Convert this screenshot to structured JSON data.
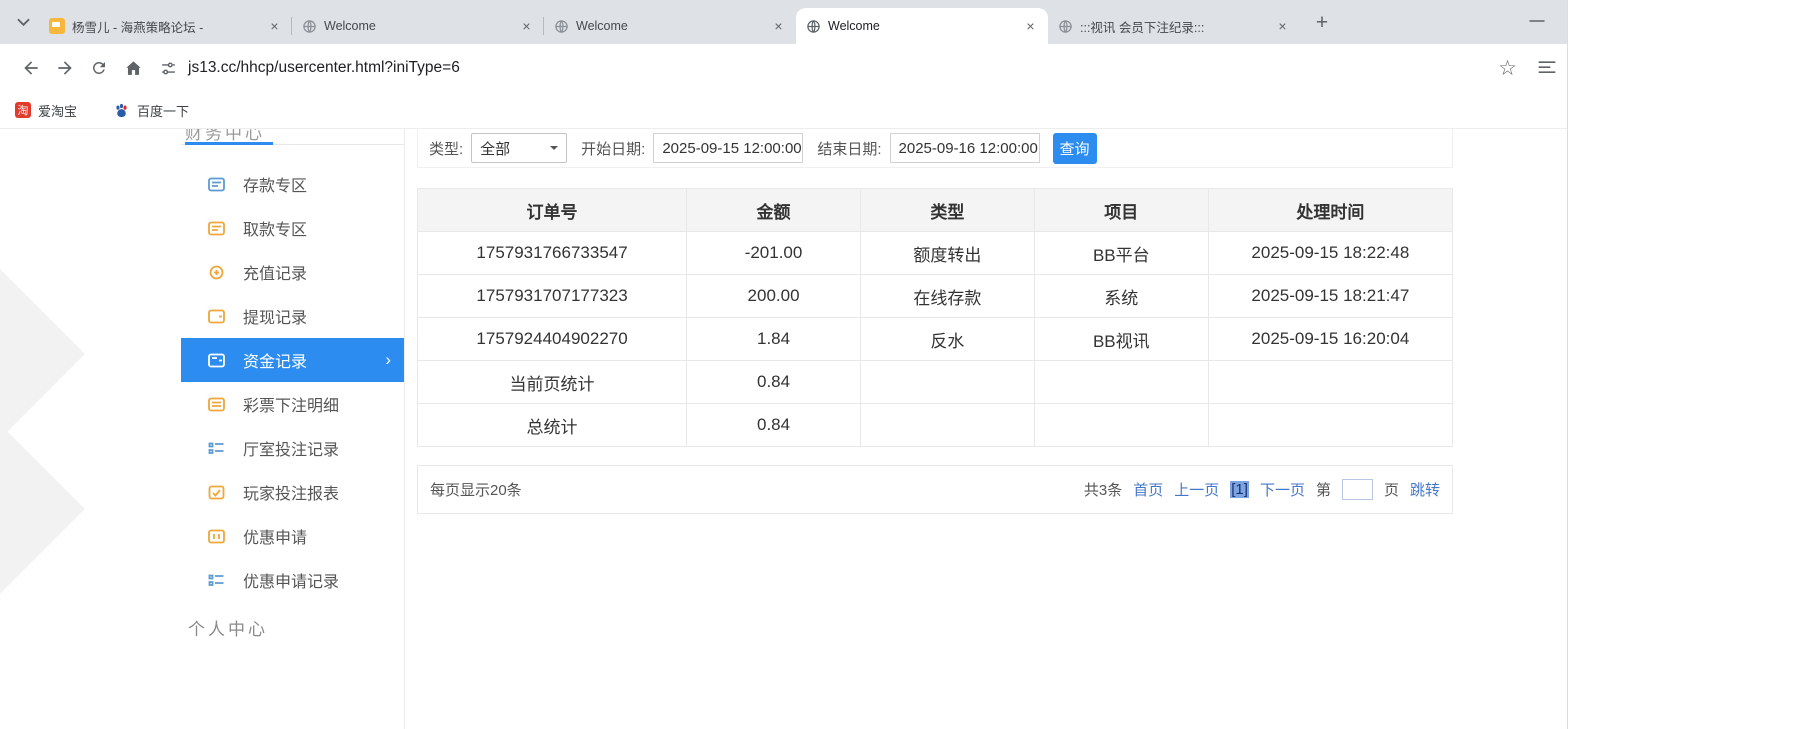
{
  "browser": {
    "tabs": [
      {
        "title": "杨雪儿 - 海燕策略论坛 -"
      },
      {
        "title": "Welcome"
      },
      {
        "title": "Welcome"
      },
      {
        "title": "Welcome"
      },
      {
        "title": ":::视讯 会员下注纪录:::"
      }
    ],
    "url": "js13.cc/hhcp/usercenter.html?iniType=6",
    "bookmarks": [
      {
        "label": "爱淘宝"
      },
      {
        "label": "百度一下"
      }
    ],
    "close_glyph": "×",
    "newtab_glyph": "+",
    "minimize_glyph": "—"
  },
  "sidebar": {
    "section_top": "财务中心",
    "items": [
      {
        "label": "存款专区"
      },
      {
        "label": "取款专区"
      },
      {
        "label": "充值记录"
      },
      {
        "label": "提现记录"
      },
      {
        "label": "资金记录",
        "active": true
      },
      {
        "label": "彩票下注明细"
      },
      {
        "label": "厅室投注记录"
      },
      {
        "label": "玩家投注报表"
      },
      {
        "label": "优惠申请"
      },
      {
        "label": "优惠申请记录"
      }
    ],
    "active_chevron": "›",
    "section_bottom": "个人中心"
  },
  "filters": {
    "type_label": "类型:",
    "type_value": "全部",
    "start_label": "开始日期:",
    "start_value": "2025-09-15 12:00:00",
    "end_label": "结束日期:",
    "end_value": "2025-09-16 12:00:00",
    "search_button": "查询"
  },
  "table": {
    "headers": [
      "订单号",
      "金额",
      "类型",
      "项目",
      "处理时间"
    ],
    "rows": [
      [
        "1757931766733547",
        "-201.00",
        "额度转出",
        "BB平台",
        "2025-09-15 18:22:48"
      ],
      [
        "1757931707177323",
        "200.00",
        "在线存款",
        "系统",
        "2025-09-15 18:21:47"
      ],
      [
        "1757924404902270",
        "1.84",
        "反水",
        "BB视讯",
        "2025-09-15 16:20:04"
      ],
      [
        "当前页统计",
        "0.84",
        "",
        "",
        ""
      ],
      [
        "总统计",
        "0.84",
        "",
        "",
        ""
      ]
    ]
  },
  "pagination": {
    "per_page": "每页显示20条",
    "total": "共3条",
    "first": "首页",
    "prev": "上一页",
    "current": "[1]",
    "next": "下一页",
    "jump_pre": "第",
    "jump_post": "页",
    "jump_go": "跳转"
  },
  "colors": {
    "accent": "#2d8cf0",
    "link": "#4577c9",
    "tabstrip_bg": "#dee1e6",
    "table_header_bg": "#f4f4f5"
  }
}
